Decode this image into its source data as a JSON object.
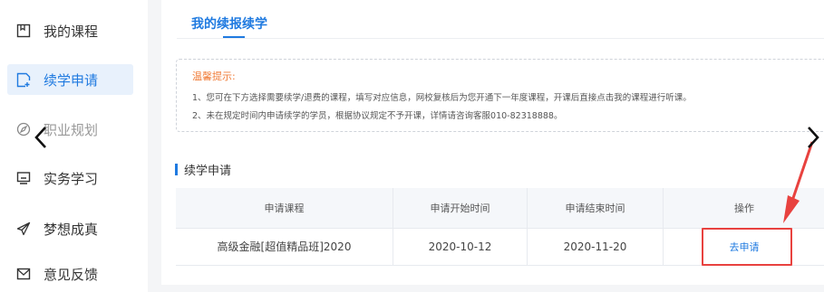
{
  "sidebar": {
    "items": [
      {
        "label": "我的课程",
        "icon": "bookmark-icon"
      },
      {
        "label": "续学申请",
        "icon": "document-add-icon",
        "active": true
      },
      {
        "label": "职业规划",
        "icon": "compass-icon"
      },
      {
        "label": "实务学习",
        "icon": "monitor-icon"
      },
      {
        "label": "梦想成真",
        "icon": "paper-plane-icon"
      },
      {
        "label": "意见反馈",
        "icon": "mail-icon"
      }
    ]
  },
  "main": {
    "tab_title": "我的续报续学",
    "notice": {
      "title": "温馨提示:",
      "lines": [
        "1、您可在下方选择需要续学/退费的课程，填写对应信息，网校复核后为您开通下一年度课程，开课后直接点击我的课程进行听课。",
        "2、未在规定时间内申请续学的学员，根据协议规定不予开课，详情请咨询客服010-82318888。"
      ]
    },
    "section_title": "续学申请",
    "table": {
      "headers": [
        "申请课程",
        "申请开始时间",
        "申请结束时间",
        "操作"
      ],
      "rows": [
        {
          "course": "高级金融[超值精品班]2020",
          "start": "2020-10-12",
          "end": "2020-11-20",
          "action": "去申请"
        }
      ]
    }
  },
  "colors": {
    "accent": "#1f7ae0",
    "highlight": "#e8423f",
    "notice_title": "#f07c38"
  }
}
